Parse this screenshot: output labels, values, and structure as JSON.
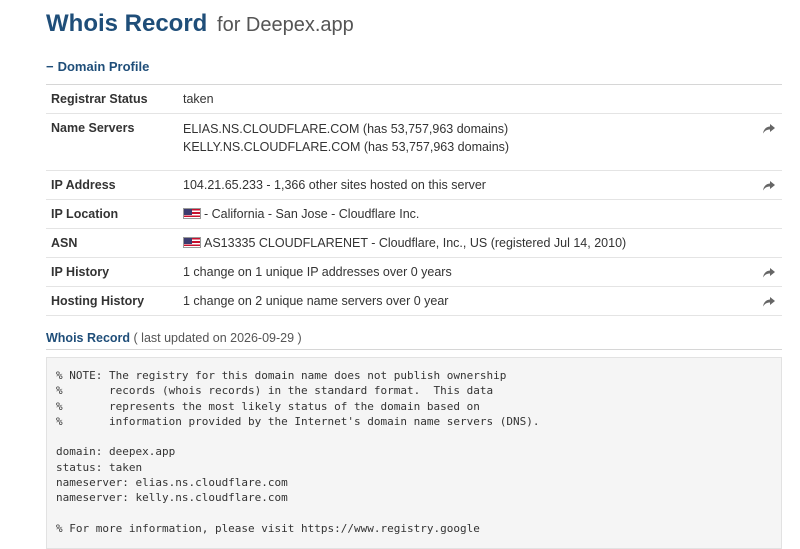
{
  "header": {
    "title": "Whois Record",
    "subtitle": "for Deepex.app"
  },
  "profile": {
    "toggle_symbol": "−",
    "section_title": "Domain Profile",
    "rows": [
      {
        "label": "Registrar Status",
        "value": "taken"
      },
      {
        "label": "Name Servers",
        "value_line1": "ELIAS.NS.CLOUDFLARE.COM (has 53,757,963 domains)",
        "value_line2": "KELLY.NS.CLOUDFLARE.COM (has 53,757,963 domains)"
      },
      {
        "label": "IP Address",
        "value": "104.21.65.233 - 1,366 other sites hosted on this server"
      },
      {
        "label": "IP Location",
        "value": "- California - San Jose - Cloudflare Inc."
      },
      {
        "label": "ASN",
        "value": "AS13335 CLOUDFLARENET - Cloudflare, Inc., US (registered Jul 14, 2010)"
      },
      {
        "label": "IP History",
        "value": "1 change on 1 unique IP addresses over 0 years"
      },
      {
        "label": "Hosting History",
        "value": "1 change on 2 unique name servers over 0 year"
      }
    ]
  },
  "whois": {
    "title": "Whois Record",
    "updated": "( last updated on 2026-09-29 )",
    "raw": "% NOTE: The registry for this domain name does not publish ownership\n%       records (whois records) in the standard format.  This data\n%       represents the most likely status of the domain based on\n%       information provided by the Internet's domain name servers (DNS).\n\ndomain: deepex.app\nstatus: taken\nnameserver: elias.ns.cloudflare.com\nnameserver: kelly.ns.cloudflare.com\n\n% For more information, please visit https://www.registry.google"
  },
  "icons": {
    "share": "share-arrow-icon",
    "flag": "us-flag-icon",
    "toggle": "minus-icon"
  },
  "colors": {
    "heading": "#1f4e79",
    "flag_red": "#c8102e",
    "flag_blue": "#3c3b6e"
  }
}
